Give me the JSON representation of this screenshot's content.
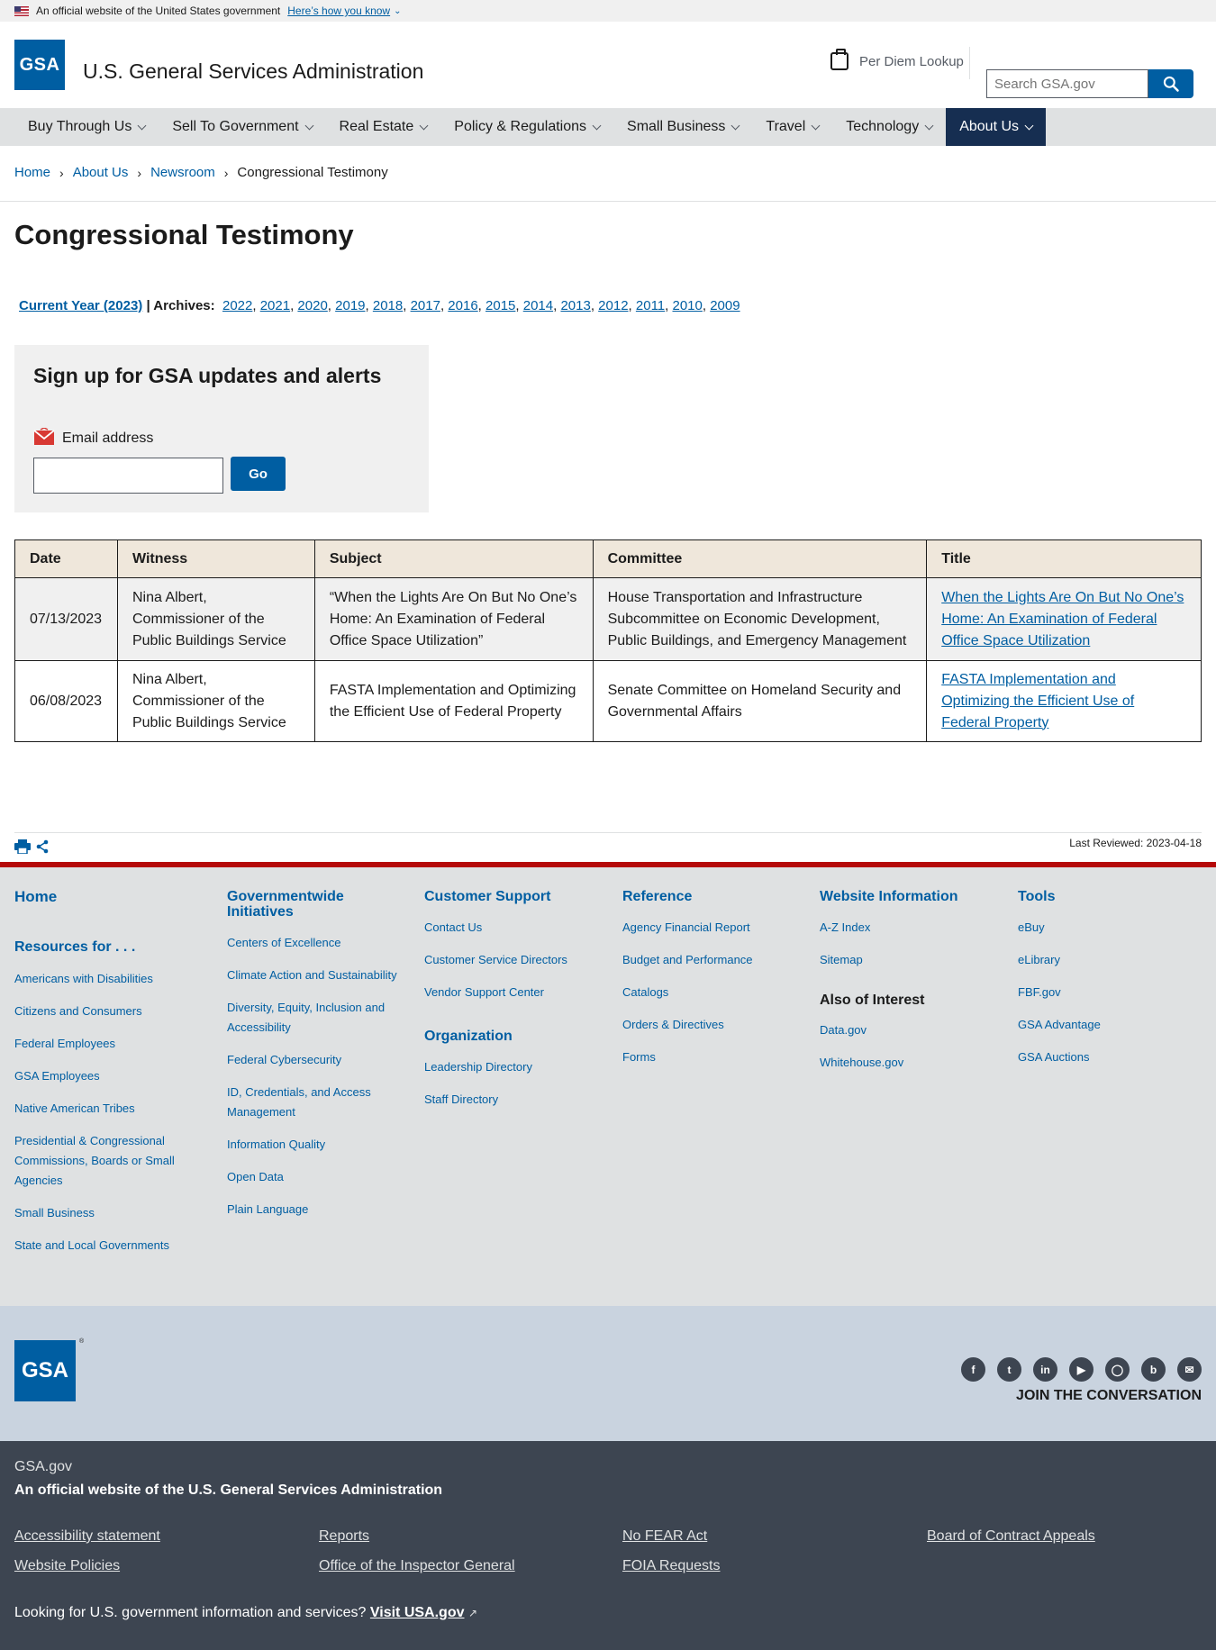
{
  "gov_banner": {
    "text": "An official website of the United States government",
    "how_link": "Here’s how you know"
  },
  "header": {
    "logo_text": "GSA",
    "agency_name": "U.S. General Services Administration",
    "per_diem_label": "Per Diem Lookup",
    "search_placeholder": "Search GSA.gov"
  },
  "nav": {
    "items": [
      "Buy Through Us",
      "Sell To Government",
      "Real Estate",
      "Policy & Regulations",
      "Small Business",
      "Travel",
      "Technology",
      "About Us"
    ],
    "active": "About Us"
  },
  "breadcrumb": [
    "Home",
    "About Us",
    "Newsroom",
    "Congressional Testimony"
  ],
  "page": {
    "title": "Congressional Testimony",
    "current_year_label": "Current Year (2023)",
    "archives_label": "| Archives:",
    "archive_years": [
      "2022",
      "2021",
      "2020",
      "2019",
      "2018",
      "2017",
      "2016",
      "2015",
      "2014",
      "2013",
      "2012",
      "2011",
      "2010",
      "2009"
    ]
  },
  "signup": {
    "heading": "Sign up for GSA updates and alerts",
    "email_label": "Email address",
    "go_label": "Go"
  },
  "table": {
    "headers": [
      "Date",
      "Witness",
      "Subject",
      "Committee",
      "Title"
    ],
    "rows": [
      {
        "date": "07/13/2023",
        "witness": "Nina Albert, Commissioner of the Public Buildings Service",
        "subject": "“When the Lights Are On But No One’s Home: An Examination of Federal Office Space Utilization”",
        "committee": "House Transportation and Infrastructure Subcommittee on Economic Development, Public Buildings, and Emergency Management",
        "title": "When the Lights Are On But No One’s Home: An Examination of Federal Office Space Utilization"
      },
      {
        "date": "06/08/2023",
        "witness": "Nina Albert, Commissioner of the Public Buildings Service",
        "subject": "FASTA Implementation and Optimizing the Efficient Use of Federal Property",
        "committee": "Senate Committee on Homeland Security and Governmental Affairs",
        "title": "FASTA Implementation and Optimizing the Efficient Use of Federal Property"
      }
    ]
  },
  "page_tools": {
    "last_reviewed": "Last Reviewed: 2023-04-18"
  },
  "footer": {
    "home": "Home",
    "resources_heading": "Resources for . . .",
    "resources": [
      "Americans with Disabilities",
      "Citizens and Consumers",
      "Federal Employees",
      "GSA Employees",
      "Native American Tribes",
      "Presidential & Congressional Commissions, Boards or Small Agencies",
      "Small Business",
      "State and Local Governments"
    ],
    "gov_heading": "Governmentwide Initiatives",
    "gov": [
      "Centers of Excellence",
      "Climate Action and Sustainability",
      "Diversity, Equity, Inclusion and Accessibility",
      "Federal Cybersecurity",
      "ID, Credentials, and Access Management",
      "Information Quality",
      "Open Data",
      "Plain Language"
    ],
    "support_heading": "Customer Support",
    "support": [
      "Contact Us",
      "Customer Service Directors",
      "Vendor Support Center"
    ],
    "org_heading": "Organization",
    "org": [
      "Leadership Directory",
      "Staff Directory"
    ],
    "ref_heading": "Reference",
    "ref": [
      "Agency Financial Report",
      "Budget and Performance",
      "Catalogs",
      "Orders & Directives",
      "Forms"
    ],
    "web_heading": "Website Information",
    "web": [
      "A-Z Index",
      "Sitemap"
    ],
    "also_heading": "Also of Interest",
    "also": [
      "Data.gov",
      "Whitehouse.gov"
    ],
    "tools_heading": "Tools",
    "tools": [
      "eBuy",
      "eLibrary",
      "FBF.gov",
      "GSA Advantage",
      "GSA Auctions"
    ],
    "logo_text": "GSA",
    "join": "JOIN THE CONVERSATION",
    "socials": [
      "facebook-icon",
      "twitter-icon",
      "linkedin-icon",
      "youtube-icon",
      "instagram-icon",
      "blog-icon",
      "email-icon"
    ],
    "site": "GSA.gov",
    "official": "An official website of the U.S. General Services Administration",
    "bottom_links": [
      "Accessibility statement",
      "Reports",
      "No FEAR Act",
      "Board of Contract Appeals",
      "Website Policies",
      "Office of the Inspector General",
      "FOIA Requests"
    ],
    "looking": "Looking for U.S. government information and services?",
    "visit": "Visit USA.gov"
  }
}
